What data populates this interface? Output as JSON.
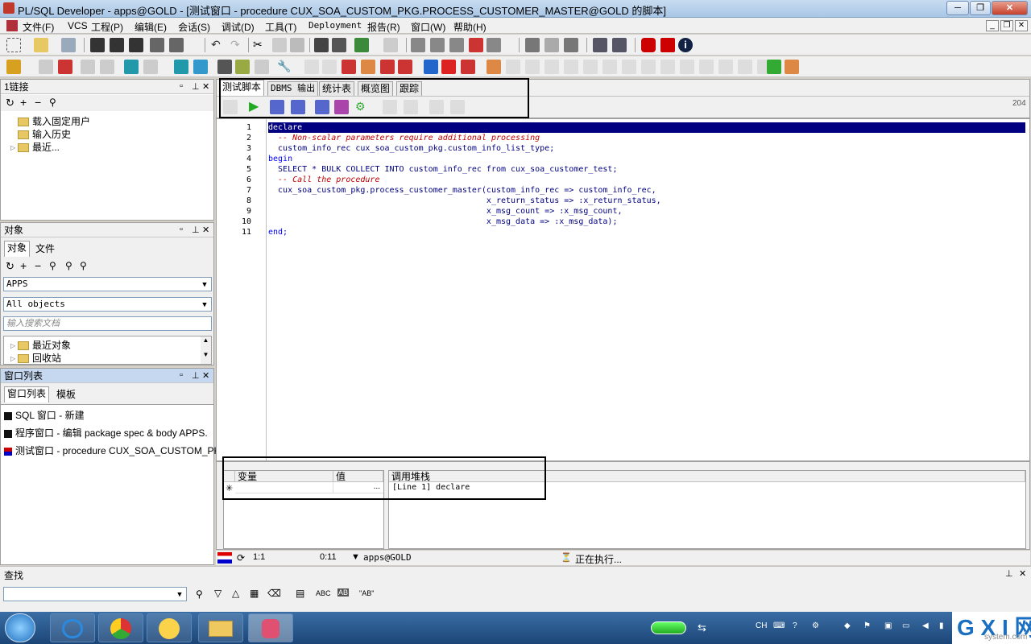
{
  "window": {
    "title": "PL/SQL Developer - apps@GOLD - [测试窗口 - procedure CUX_SOA_CUSTOM_PKG.PROCESS_CUSTOMER_MASTER@GOLD 的脚本]",
    "minimize": "─",
    "restore": "❐",
    "close": "✕"
  },
  "menu": [
    "文件(F)",
    "VCS",
    "工程(P)",
    "编辑(E)",
    "会话(S)",
    "调试(D)",
    "工具(T)",
    "Deployment",
    "报告(R)",
    "窗口(W)",
    "帮助(H)"
  ],
  "connections_panel": {
    "title": "1链接",
    "items": [
      "载入固定用户",
      "输入历史",
      "最近..."
    ]
  },
  "objects_panel": {
    "title": "对象",
    "tabs": [
      "对象",
      "文件"
    ],
    "owner": "APPS",
    "filter": "All objects",
    "search_placeholder": "输入搜索文档",
    "items": [
      "最近对象",
      "回收站"
    ]
  },
  "window_list_panel": {
    "title": "窗口列表",
    "tabs": [
      "窗口列表",
      "模板"
    ],
    "items": [
      "SQL 窗口 - 新建",
      "程序窗口 - 编辑 package spec & body APPS.",
      "测试窗口 - procedure CUX_SOA_CUSTOM_PKG.I"
    ]
  },
  "editor_tabs": [
    "测试脚本",
    "DBMS 输出",
    "统计表",
    "概览图",
    "跟踪"
  ],
  "editor": {
    "position_hint": "204",
    "lines": [
      {
        "n": "1",
        "text": "declare"
      },
      {
        "n": "2",
        "text": "  -- Non-scalar parameters require additional processing"
      },
      {
        "n": "3",
        "text": "  custom_info_rec cux_soa_custom_pkg.custom_info_list_type;"
      },
      {
        "n": "4",
        "text": "begin"
      },
      {
        "n": "5",
        "text": "  SELECT * BULK COLLECT INTO custom_info_rec from cux_soa_customer_test;"
      },
      {
        "n": "6",
        "text": "  -- Call the procedure"
      },
      {
        "n": "7",
        "text": "  cux_soa_custom_pkg.process_customer_master(custom_info_rec => custom_info_rec,"
      },
      {
        "n": "8",
        "text": "                                             x_return_status => :x_return_status,"
      },
      {
        "n": "9",
        "text": "                                             x_msg_count => :x_msg_count,"
      },
      {
        "n": "10",
        "text": "                                             x_msg_data => :x_msg_data);"
      },
      {
        "n": "11",
        "text": "end;"
      }
    ]
  },
  "debug": {
    "var_header": "变量",
    "val_header": "值",
    "stack_header": "调用堆栈",
    "row_marker": "✳",
    "ellipsis": "...",
    "stack_row": "[Line 1] declare"
  },
  "status": {
    "cursor": "1:1",
    "elapsed": "0:11",
    "connection": "apps@GOLD",
    "state": "正在执行..."
  },
  "find": {
    "title": "查找",
    "pin": "⊥",
    "close": "✕",
    "abc": "ABC",
    "quoted": "\"AB\""
  },
  "taskbar": {
    "lang": "CH",
    "watermark": "G X I 网",
    "watermark_sub": "system.com"
  }
}
